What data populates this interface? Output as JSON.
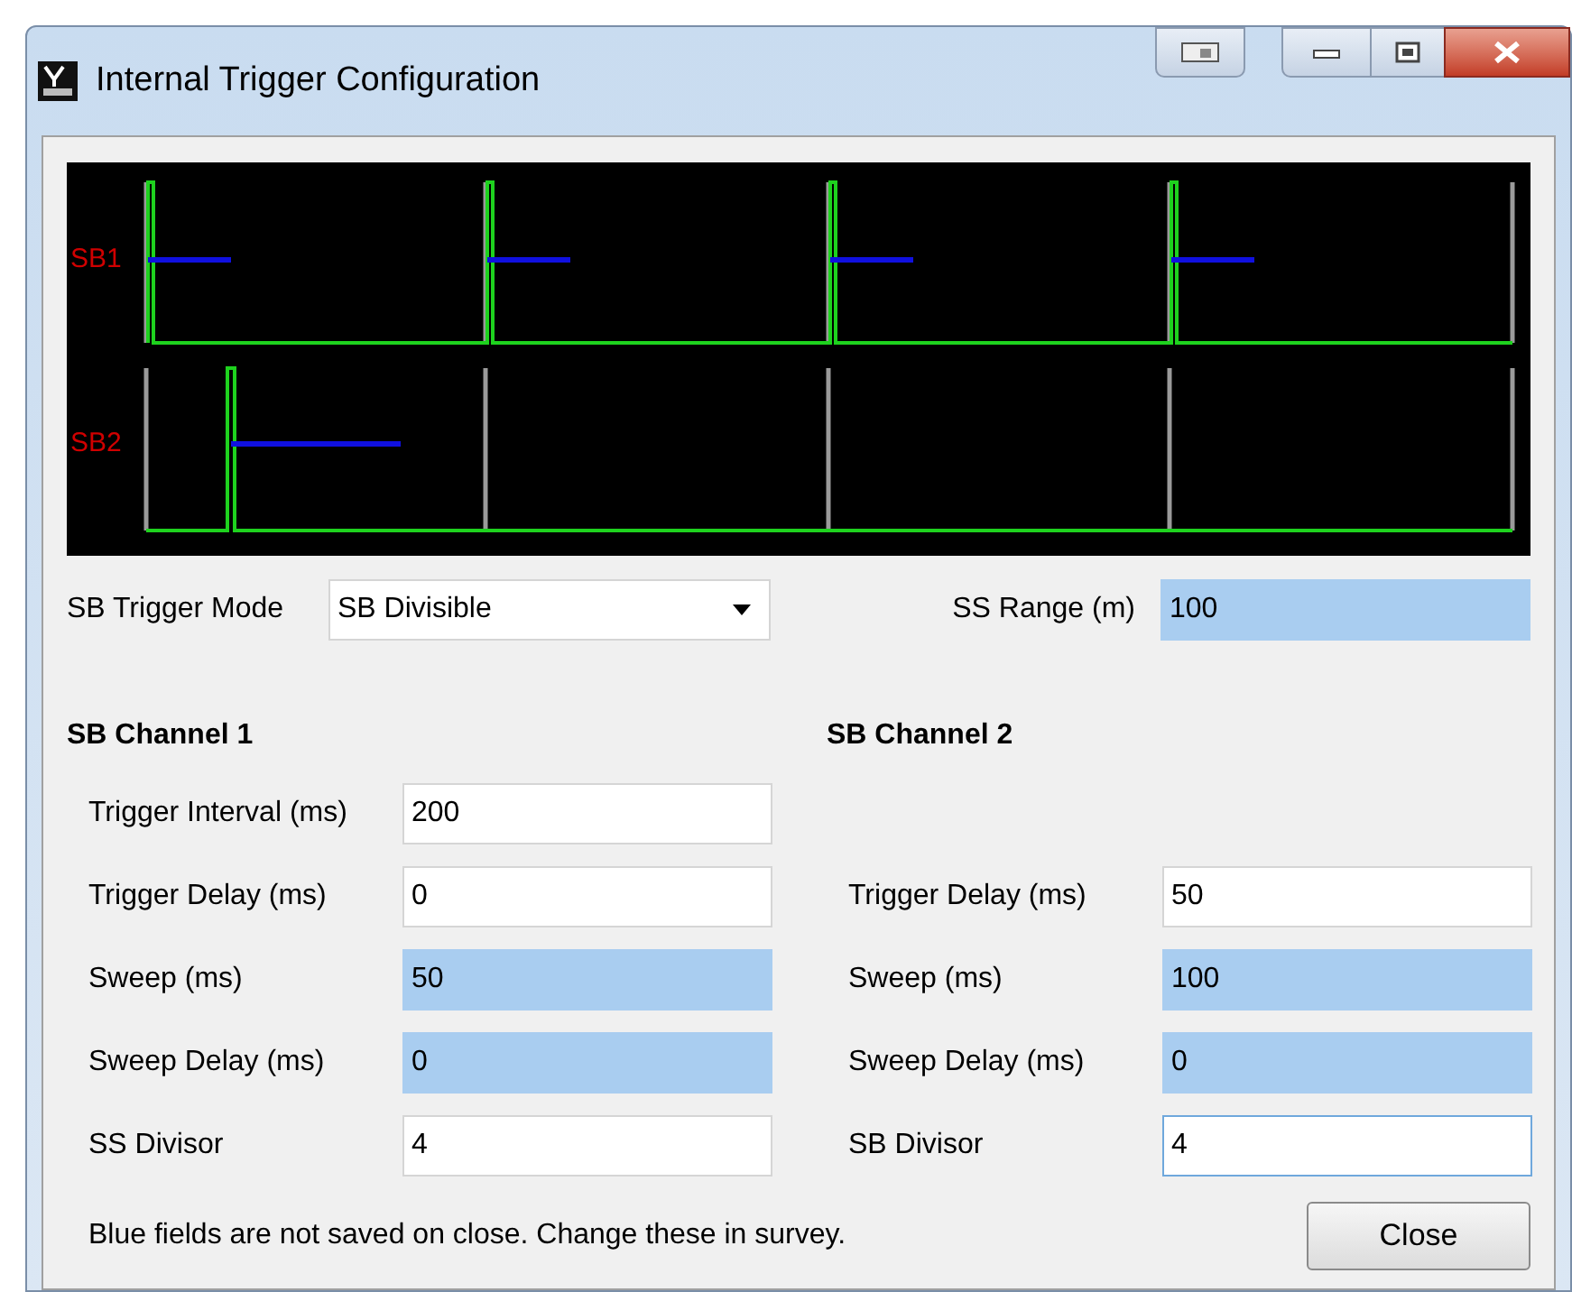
{
  "window": {
    "title": "Internal Trigger Configuration"
  },
  "timing_diagram": {
    "channels": [
      {
        "label": "SB1"
      },
      {
        "label": "SB2"
      }
    ]
  },
  "trigger_mode": {
    "label": "SB Trigger Mode",
    "value": "SB Divisible"
  },
  "ss_range": {
    "label": "SS Range (m)",
    "value": "100",
    "readonly": true
  },
  "channels": [
    {
      "title": "SB Channel 1",
      "fields": [
        {
          "label": "Trigger Interval (ms)",
          "value": "200",
          "readonly": false,
          "focused": false
        },
        {
          "label": "Trigger Delay (ms)",
          "value": "0",
          "readonly": false,
          "focused": false
        },
        {
          "label": "Sweep (ms)",
          "value": "50",
          "readonly": true,
          "focused": false
        },
        {
          "label": "Sweep Delay (ms)",
          "value": "0",
          "readonly": true,
          "focused": false
        },
        {
          "label": "SS Divisor",
          "value": "4",
          "readonly": false,
          "focused": false
        }
      ]
    },
    {
      "title": "SB Channel 2",
      "fields": [
        {
          "label": "Trigger Delay (ms)",
          "value": "50",
          "readonly": false,
          "focused": false
        },
        {
          "label": "Sweep (ms)",
          "value": "100",
          "readonly": true,
          "focused": false
        },
        {
          "label": "Sweep Delay (ms)",
          "value": "0",
          "readonly": true,
          "focused": false
        },
        {
          "label": "SB Divisor",
          "value": "4",
          "readonly": false,
          "focused": true
        }
      ]
    }
  ],
  "note": "Blue fields are not saved on close. Change these in survey.",
  "buttons": [
    {
      "label": "Close"
    }
  ]
}
